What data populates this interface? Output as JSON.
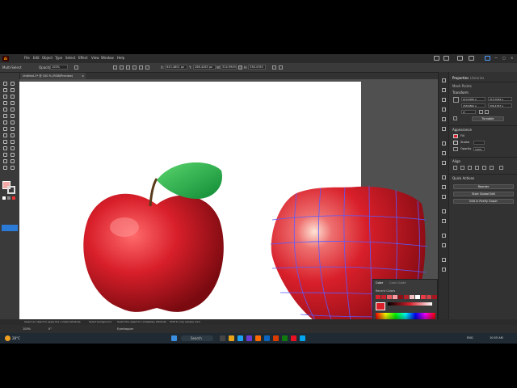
{
  "menubar": {
    "items": [
      "File",
      "Edit",
      "Object",
      "Type",
      "Select",
      "Effect",
      "View",
      "Window",
      "Help"
    ]
  },
  "controlbar": {
    "left_label": "Multi-Select",
    "opacity_label": "Opacity:",
    "opacity_value": "100%",
    "x_label": "X:",
    "x_value": "643.4601 px",
    "y_label": "Y:",
    "y_value": "266.4265 px",
    "w_label": "W:",
    "w_value": "314.9949 px",
    "h_label": "H:",
    "h_value": "336.4763 px"
  },
  "document": {
    "tab_title": "Untitled-1* @ 100 % (RGB/Preview)",
    "close": "×"
  },
  "properties_panel": {
    "tabs": [
      "Properties",
      "Libraries"
    ],
    "section_mesh": "Mesh Points",
    "section_transform": "Transform",
    "x_value": "619.9981 p",
    "y_value": "258.8861 p",
    "w_value": "315.0049 p",
    "h_value": "336.4767 p",
    "angle_value": "0°",
    "turnable_btn": "Turnable",
    "section_appearance": "Appearance",
    "fill_label": "Fill",
    "stroke_label": "Stroke",
    "opacity_label": "Opacity",
    "opacity_value": "100%",
    "section_align": "Align",
    "section_quick_actions": "Quick Actions",
    "btn_reorder": "Reorder",
    "btn_start_global_edit": "Start Global Edit",
    "btn_edit_firefly": "Edit in Firefly Graph"
  },
  "color_panel": {
    "tabs": [
      "Color",
      "Color Guide"
    ],
    "recent_label": "Recent Colors",
    "swatches": [
      "#d81f2a",
      "#c41f2a",
      "#e85a5f",
      "#ff9aa0",
      "#8a1015",
      "#b52028",
      "#f0c0c0",
      "#ffffff",
      "#ea3a45",
      "#d04048",
      "#a81520"
    ]
  },
  "statusbar": {
    "hint1": "Select an object to apply the curated attribute",
    "hint2": "Select background",
    "hint3": "Select the object to completely attribute",
    "hint4": "Shift to only sample color"
  },
  "statusbar2": {
    "zoom": "100%",
    "angle": "0°",
    "tool_name": "Eyedropper"
  },
  "taskbar": {
    "weather": "28°C",
    "search_placeholder": "Search",
    "lang": "ENG",
    "time": "10:55 AM"
  },
  "colors": {
    "apple_red": "#d81f2a",
    "leaf_green": "#1ea84a",
    "mesh_line": "#5a5aff",
    "accent_blue": "#2b7bd6"
  }
}
